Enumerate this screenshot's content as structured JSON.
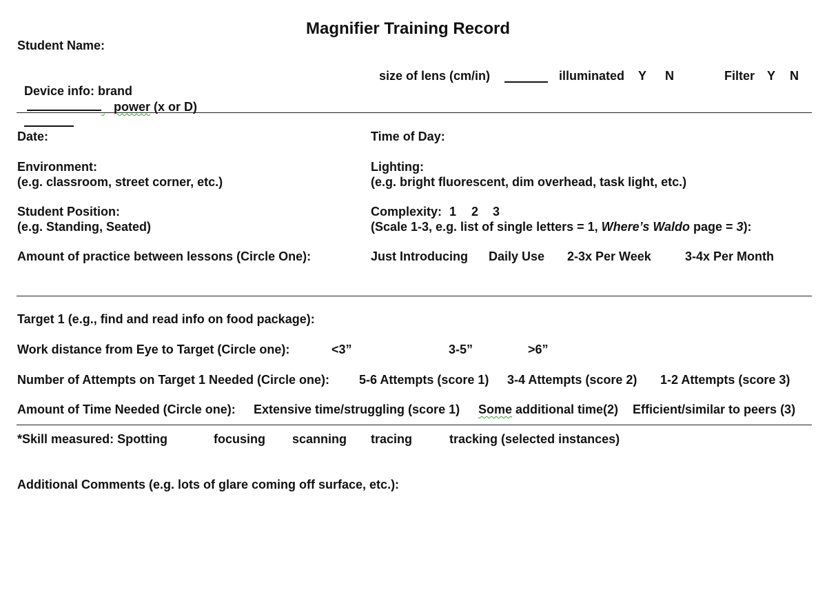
{
  "title": "Magnifier Training Record",
  "student_name_label": "Student Name:",
  "device": {
    "brand_label": "Device info: brand",
    "power_label": "power",
    "power_suffix": " (x or D)",
    "lens_label": "size of lens (cm/in)",
    "illuminated_label": "illuminated",
    "illuminated_yes": "Y",
    "illuminated_no": "N",
    "filter_label": "Filter",
    "filter_yes": "Y",
    "filter_no": "N"
  },
  "session": {
    "date_label": "Date:",
    "time_label": "Time of Day:",
    "environment_label": "Environment:",
    "environment_hint": "(e.g. classroom, street corner, etc.)",
    "lighting_label": "Lighting:",
    "lighting_hint": "(e.g. bright fluorescent, dim overhead, task light, etc.)",
    "position_label": "Student Position:",
    "position_hint": "(e.g. Standing, Seated)",
    "complexity_label": "Complexity:",
    "complexity_options": [
      "1",
      "2",
      "3"
    ],
    "complexity_hint_pre": "(Scale 1-3, e.g. list of single letters = 1, ",
    "complexity_hint_italic": "Where’s Waldo",
    "complexity_hint_mid": " page = ",
    "complexity_hint_italic2": "3",
    "complexity_hint_post": "):",
    "practice_label": "Amount of practice between lessons (Circle One):",
    "practice_options": [
      "Just Introducing",
      "Daily Use",
      "2-3x Per Week",
      "3-4x Per Month"
    ]
  },
  "target": {
    "target_label": "Target 1 (e.g., find and read info on food package):",
    "distance_label": "Work distance from Eye to Target (Circle one):",
    "distance_options": [
      "<3”",
      "3-5”",
      ">6”"
    ],
    "attempts_label": "Number of Attempts on Target 1 Needed (Circle one):",
    "attempts_options": [
      "5-6 Attempts (score 1)",
      "3-4 Attempts (score 2)",
      "1-2 Attempts (score 3)"
    ],
    "time_label": "Amount of Time Needed (Circle one):",
    "time_option1": "Extensive time/struggling (score 1)",
    "time_option2_word": "Some",
    "time_option2_rest": " additional time(2)",
    "time_option3": "Efficient/similar to peers (3)"
  },
  "skills": {
    "label": "*Skill measured: Spotting",
    "options": [
      "focusing",
      "scanning",
      "tracing",
      "tracking (selected instances)"
    ]
  },
  "comments_label": "Additional Comments (e.g. lots of glare coming off surface, etc.):"
}
